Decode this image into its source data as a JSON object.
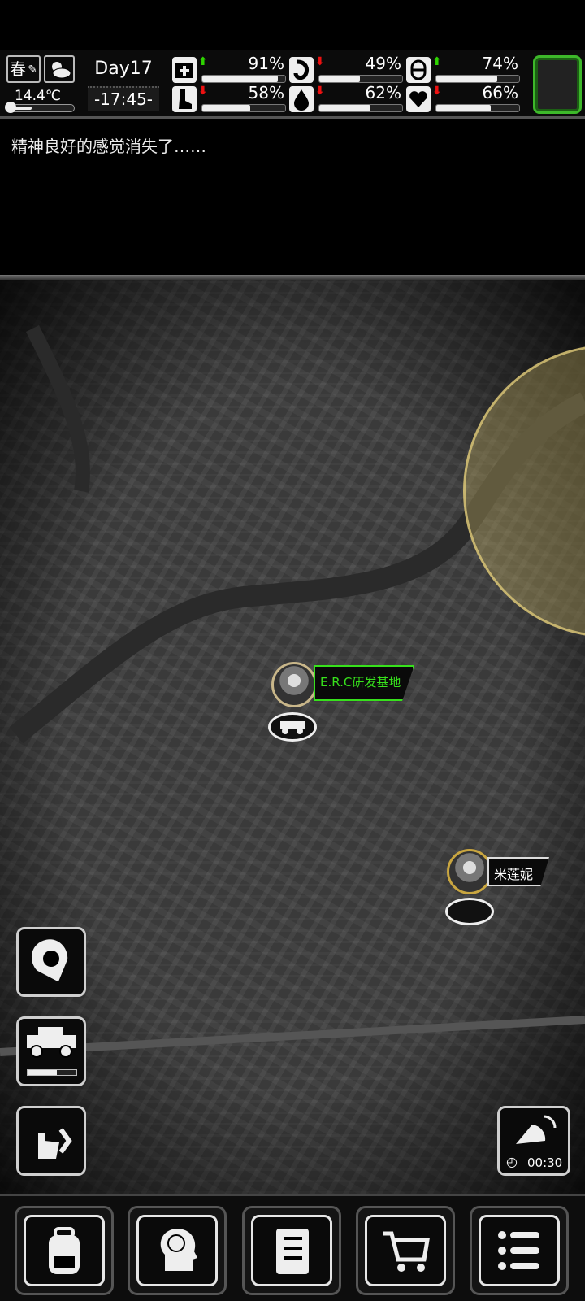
{
  "hud": {
    "season": "春",
    "temperature": "14.4℃",
    "temperature_level": 0.32,
    "day": "Day17",
    "time": "-17:45-",
    "stats": [
      {
        "name": "health",
        "icon": "medkit-icon",
        "trend": "up",
        "value": "91%",
        "level": 0.91
      },
      {
        "name": "hunger",
        "icon": "stomach-icon",
        "trend": "down",
        "value": "49%",
        "level": 0.49
      },
      {
        "name": "mood",
        "icon": "pill-icon",
        "trend": "up",
        "value": "74%",
        "level": 0.74
      },
      {
        "name": "stamina",
        "icon": "foot-icon",
        "trend": "down",
        "value": "58%",
        "level": 0.58
      },
      {
        "name": "thirst",
        "icon": "water-drop-icon",
        "trend": "down",
        "value": "62%",
        "level": 0.62
      },
      {
        "name": "spirit",
        "icon": "heart-icon",
        "trend": "down",
        "value": "66%",
        "level": 0.66
      }
    ]
  },
  "log": {
    "message": "精神良好的感觉消失了……"
  },
  "map": {
    "locations": [
      {
        "label": "E.R.C研发基地"
      },
      {
        "label": "米莲妮"
      }
    ],
    "vehicle_fuel_level": 0.6,
    "radar_timer": "00:30"
  },
  "colors": {
    "accent_green": "#37e11c",
    "arrow_up": "#2ed400",
    "arrow_down": "#e11111"
  }
}
